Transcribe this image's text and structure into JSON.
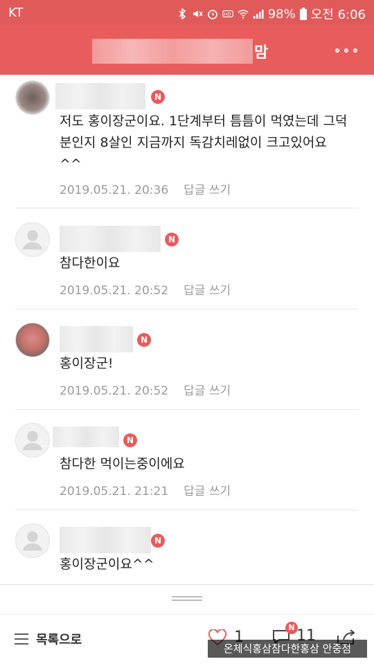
{
  "status_bar": {
    "carrier": "KT",
    "battery": "98%",
    "time": "오전 6:06"
  },
  "header": {
    "title_visible_suffix": "맘",
    "more_icon": "more-icon"
  },
  "comments": [
    {
      "text": "저도 홍이장군이요. 1단계부터 틈틈이 먹였는데 그덕분인지 8살인 지금까지 독감치레없이 크고있어요 ^^",
      "date": "2019.05.21. 20:36",
      "reply_label": "답글 쓰기",
      "badge": "N"
    },
    {
      "text": "참다한이요",
      "date": "2019.05.21. 20:52",
      "reply_label": "답글 쓰기",
      "badge": "N"
    },
    {
      "text": "홍이장군!",
      "date": "2019.05.21. 20:52",
      "reply_label": "답글 쓰기",
      "badge": "N"
    },
    {
      "text": "참다한 먹이는중이에요",
      "date": "2019.05.21. 21:21",
      "reply_label": "답글 쓰기",
      "badge": "N"
    },
    {
      "text": "홍이장군이요^^",
      "date": "",
      "reply_label": "",
      "badge": "N"
    }
  ],
  "toolbar": {
    "list_label": "목록으로",
    "like_count": "1",
    "comment_badge": "N",
    "comment_count": "11"
  },
  "watermark": "온체식홍삼참다한홍삼 안중점",
  "colors": {
    "accent": "#e85c5c",
    "meta": "#9a9a9a"
  }
}
